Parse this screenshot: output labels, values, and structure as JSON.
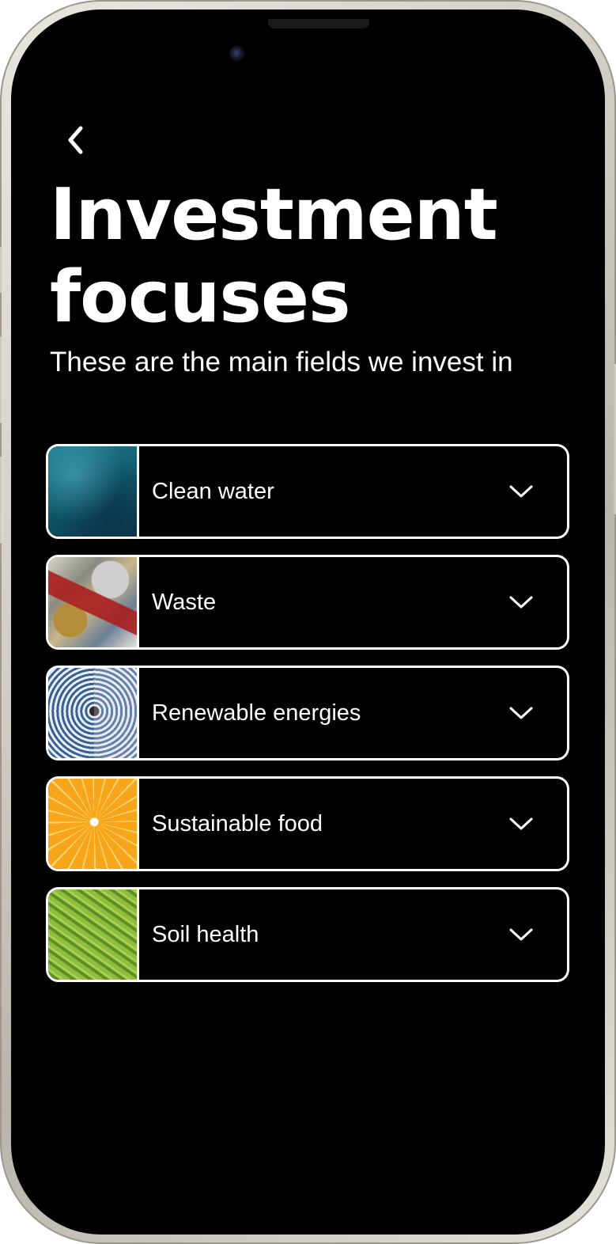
{
  "header": {
    "back_icon": "chevron-left-icon",
    "title": "Investment\nfocuses",
    "subtitle": "These are the main fields we invest in"
  },
  "focus_items": [
    {
      "label": "Clean water",
      "thumbnail": "water-image",
      "icon": "chevron-down-icon"
    },
    {
      "label": "Waste",
      "thumbnail": "waste-image",
      "icon": "chevron-down-icon"
    },
    {
      "label": "Renewable energies",
      "thumbnail": "energy-image",
      "icon": "chevron-down-icon"
    },
    {
      "label": "Sustainable food",
      "thumbnail": "food-image",
      "icon": "chevron-down-icon"
    },
    {
      "label": "Soil health",
      "thumbnail": "soil-image",
      "icon": "chevron-down-icon"
    }
  ],
  "colors": {
    "background": "#000000",
    "text": "#ffffff",
    "border": "#ffffff",
    "frame": "#d8d5cd"
  }
}
